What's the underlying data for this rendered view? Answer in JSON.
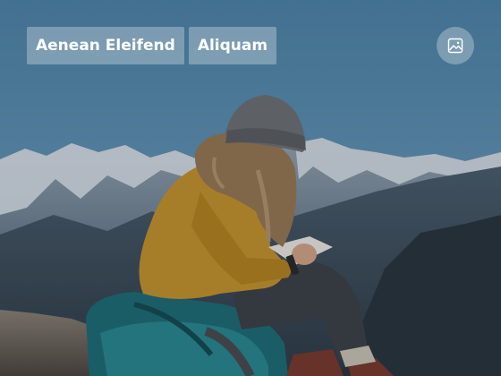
{
  "card": {
    "tags": [
      "Aenean Eleifend",
      "Aliquam"
    ],
    "media_button_icon": "image-icon"
  },
  "colors": {
    "tag_background": "rgba(200,212,222,0.42)",
    "tag_text": "#ffffff",
    "sky": "#5e92b5"
  }
}
